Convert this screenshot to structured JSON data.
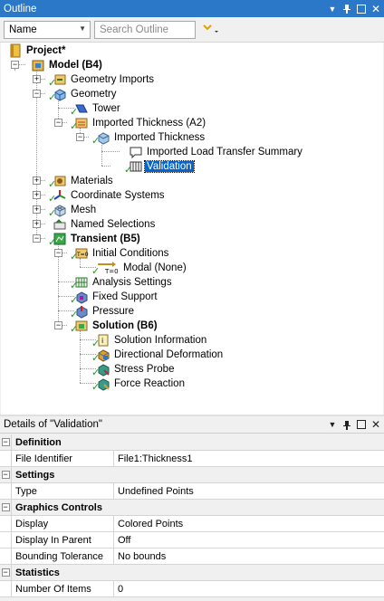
{
  "outline_panel": {
    "title": "Outline",
    "name_filter": "Name",
    "search_placeholder": "Search Outline"
  },
  "tree": {
    "project": "Project*",
    "model": "Model (B4)",
    "geometry_imports": "Geometry Imports",
    "geometry": "Geometry",
    "tower": "Tower",
    "imported_thickness_a2": "Imported Thickness (A2)",
    "imported_thickness": "Imported Thickness",
    "imported_load_transfer_summary": "Imported Load Transfer Summary",
    "validation": "Validation",
    "materials": "Materials",
    "coordinate_systems": "Coordinate Systems",
    "mesh": "Mesh",
    "named_selections": "Named Selections",
    "transient": "Transient (B5)",
    "initial_conditions": "Initial Conditions",
    "modal_none": "Modal (None)",
    "analysis_settings": "Analysis Settings",
    "fixed_support": "Fixed Support",
    "pressure": "Pressure",
    "solution": "Solution (B6)",
    "solution_information": "Solution Information",
    "directional_deformation": "Directional Deformation",
    "stress_probe": "Stress Probe",
    "force_reaction": "Force Reaction"
  },
  "details_panel": {
    "title": "Details of \"Validation\"",
    "sections": {
      "definition": "Definition",
      "settings": "Settings",
      "graphics_controls": "Graphics Controls",
      "statistics": "Statistics"
    },
    "rows": {
      "file_identifier": {
        "name": "File Identifier",
        "value": "File1:Thickness1"
      },
      "type": {
        "name": "Type",
        "value": "Undefined Points"
      },
      "display": {
        "name": "Display",
        "value": "Colored Points"
      },
      "display_in_parent": {
        "name": "Display In Parent",
        "value": "Off"
      },
      "bounding_tolerance": {
        "name": "Bounding Tolerance",
        "value": "No bounds"
      },
      "number_of_items": {
        "name": "Number Of Items",
        "value": "0"
      }
    }
  },
  "colors": {
    "header_blue": "#2b78c8",
    "selection_blue": "#0a64c4",
    "check_green": "#1a9a1a"
  }
}
